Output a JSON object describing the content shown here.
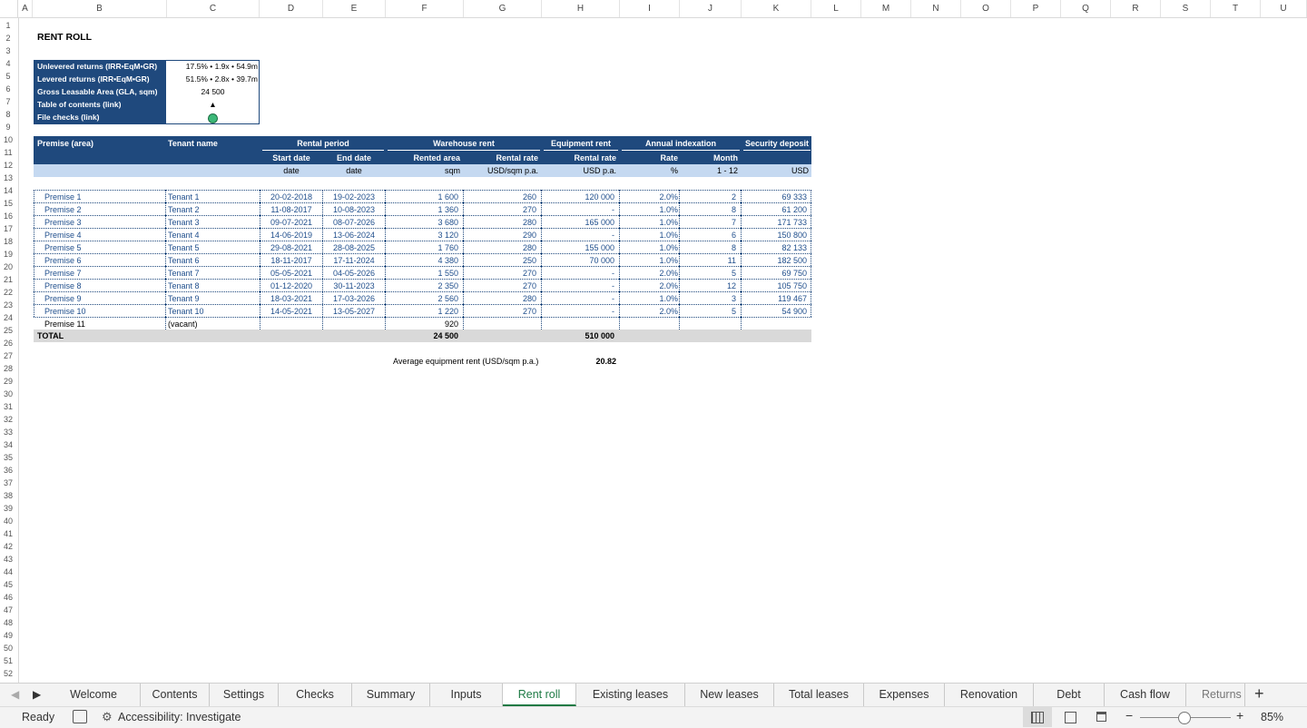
{
  "columns": [
    "A",
    "B",
    "C",
    "D",
    "E",
    "F",
    "G",
    "H",
    "I",
    "J",
    "K",
    "L",
    "M",
    "N",
    "O",
    "P",
    "Q",
    "R",
    "S",
    "T",
    "U"
  ],
  "rows": [
    "1",
    "2",
    "3",
    "4",
    "5",
    "6",
    "7",
    "8",
    "9",
    "10",
    "11",
    "12",
    "13",
    "14",
    "15",
    "16",
    "17",
    "18",
    "19",
    "20",
    "21",
    "22",
    "23",
    "24",
    "25",
    "26",
    "27",
    "28",
    "29",
    "30",
    "31",
    "32",
    "33",
    "34",
    "35",
    "36",
    "37",
    "38",
    "39",
    "40",
    "41",
    "42",
    "43",
    "44",
    "45",
    "46",
    "47",
    "48",
    "49",
    "50",
    "51",
    "52"
  ],
  "sheet": {
    "title": "RENT ROLL",
    "summary": [
      {
        "label": "Unlevered returns (IRR•EqM•GR)",
        "value": "17.5% • 1.9x • 54.9m"
      },
      {
        "label": "Levered returns (IRR•EqM•GR)",
        "value": "51.5% • 2.8x • 39.7m"
      },
      {
        "label": "Gross Leasable Area (GLA, sqm)",
        "value": "24 500"
      },
      {
        "label": "Table of contents (link)",
        "value": "▲"
      },
      {
        "label": "File checks (link)",
        "value": ""
      }
    ],
    "header": {
      "premise": "Premise (area)",
      "tenant": "Tenant name",
      "rental_period": "Rental period",
      "warehouse_rent": "Warehouse rent",
      "equipment_rent": "Equipment rent",
      "annual_indexation": "Annual indexation",
      "security_deposit": "Security deposit",
      "start_date": "Start date",
      "end_date": "End date",
      "rented_area": "Rented area",
      "rental_rate": "Rental rate",
      "equip_rental_rate": "Rental rate",
      "rate": "Rate",
      "month": "Month",
      "u_date1": "date",
      "u_date2": "date",
      "u_sqm": "sqm",
      "u_usdsqm": "USD/sqm p.a.",
      "u_usdpa": "USD p.a.",
      "u_pct": "%",
      "u_month": "1 - 12",
      "u_usd": "USD"
    },
    "table": [
      {
        "premise": "Premise 1",
        "tenant": "Tenant 1",
        "start": "20-02-2018",
        "end": "19-02-2023",
        "area": "1 600",
        "rate": "260",
        "equip": "120 000",
        "idx": "2.0%",
        "month": "2",
        "deposit": "69 333"
      },
      {
        "premise": "Premise 2",
        "tenant": "Tenant 2",
        "start": "11-08-2017",
        "end": "10-08-2023",
        "area": "1 360",
        "rate": "270",
        "equip": "-",
        "idx": "1.0%",
        "month": "8",
        "deposit": "61 200"
      },
      {
        "premise": "Premise 3",
        "tenant": "Tenant 3",
        "start": "09-07-2021",
        "end": "08-07-2026",
        "area": "3 680",
        "rate": "280",
        "equip": "165 000",
        "idx": "1.0%",
        "month": "7",
        "deposit": "171 733"
      },
      {
        "premise": "Premise 4",
        "tenant": "Tenant 4",
        "start": "14-06-2019",
        "end": "13-06-2024",
        "area": "3 120",
        "rate": "290",
        "equip": "-",
        "idx": "1.0%",
        "month": "6",
        "deposit": "150 800"
      },
      {
        "premise": "Premise 5",
        "tenant": "Tenant 5",
        "start": "29-08-2021",
        "end": "28-08-2025",
        "area": "1 760",
        "rate": "280",
        "equip": "155 000",
        "idx": "1.0%",
        "month": "8",
        "deposit": "82 133"
      },
      {
        "premise": "Premise 6",
        "tenant": "Tenant 6",
        "start": "18-11-2017",
        "end": "17-11-2024",
        "area": "4 380",
        "rate": "250",
        "equip": "70 000",
        "idx": "1.0%",
        "month": "11",
        "deposit": "182 500"
      },
      {
        "premise": "Premise 7",
        "tenant": "Tenant 7",
        "start": "05-05-2021",
        "end": "04-05-2026",
        "area": "1 550",
        "rate": "270",
        "equip": "-",
        "idx": "2.0%",
        "month": "5",
        "deposit": "69 750"
      },
      {
        "premise": "Premise 8",
        "tenant": "Tenant 8",
        "start": "01-12-2020",
        "end": "30-11-2023",
        "area": "2 350",
        "rate": "270",
        "equip": "-",
        "idx": "2.0%",
        "month": "12",
        "deposit": "105 750"
      },
      {
        "premise": "Premise 9",
        "tenant": "Tenant 9",
        "start": "18-03-2021",
        "end": "17-03-2026",
        "area": "2 560",
        "rate": "280",
        "equip": "-",
        "idx": "1.0%",
        "month": "3",
        "deposit": "119 467"
      },
      {
        "premise": "Premise 10",
        "tenant": "Tenant 10",
        "start": "14-05-2021",
        "end": "13-05-2027",
        "area": "1 220",
        "rate": "270",
        "equip": "-",
        "idx": "2.0%",
        "month": "5",
        "deposit": "54 900"
      },
      {
        "premise": "Premise 11",
        "tenant": "(vacant)",
        "start": "",
        "end": "",
        "area": "920",
        "rate": "",
        "equip": "",
        "idx": "",
        "month": "",
        "deposit": ""
      }
    ],
    "total": {
      "label": "TOTAL",
      "area": "24 500",
      "equip": "510 000"
    },
    "avg": {
      "label": "Average equipment rent (USD/sqm p.a.)",
      "value": "20.82"
    }
  },
  "tabs": [
    "Welcome",
    "Contents",
    "Settings",
    "Checks",
    "Summary",
    "Inputs",
    "Rent roll",
    "Existing leases",
    "New leases",
    "Total leases",
    "Expenses",
    "Renovation",
    "Debt",
    "Cash flow",
    "Returns"
  ],
  "active_tab": "Rent roll",
  "status": {
    "ready": "Ready",
    "accessibility": "Accessibility: Investigate",
    "zoom": "85%",
    "zoom_level": 0.85
  },
  "colors": {
    "navy": "#1f497d",
    "light_blue": "#c5d9f1",
    "total_grey": "#d9d9d9",
    "accent_green": "#1d7a44"
  }
}
